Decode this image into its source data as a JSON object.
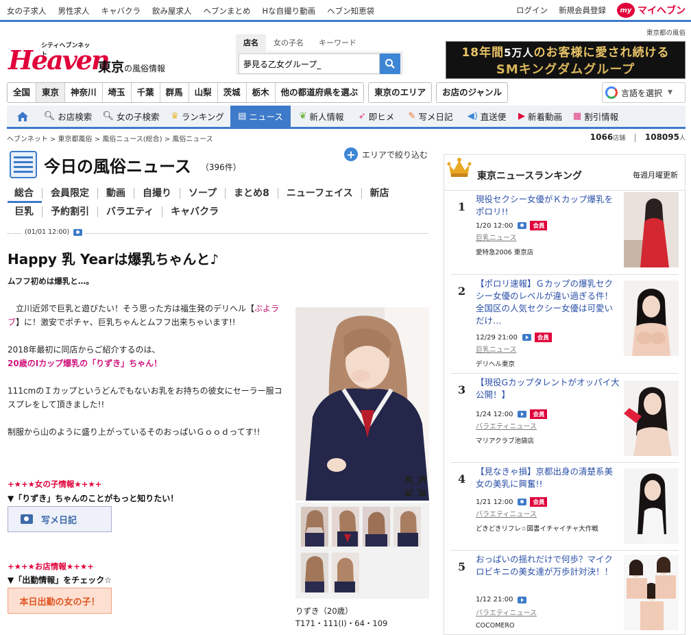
{
  "topbar": {
    "links": [
      "女の子求人",
      "男性求人",
      "キャバクラ",
      "飲み屋求人",
      "ヘブンまとめ",
      "Hな自撮り動画",
      "ヘブン知恵袋"
    ],
    "login": "ログイン",
    "register": "新規会員登録",
    "my_badge": "my",
    "my_heaven": "マイヘブン"
  },
  "header": {
    "pref_label": "東京都の風俗",
    "logo_small": "シティヘブンネット",
    "logo_big": "Heaven",
    "region": "東京",
    "region_sub": "の風俗情報",
    "search_tabs": [
      "店名",
      "女の子名",
      "キーワード"
    ],
    "search_value": "夢見る乙女グループ_",
    "banner_line1_a": "18年間",
    "banner_line1_b": "5万人",
    "banner_line1_c": "のお客様に愛され続ける",
    "banner_line2": "SMキングダムグループ"
  },
  "areas": [
    "全国",
    "東京",
    "神奈川",
    "埼玉",
    "千葉",
    "群馬",
    "山梨",
    "茨城",
    "栃木",
    "他の都道府県を選ぶ"
  ],
  "area_link": "東京のエリア",
  "genre_link": "お店のジャンル",
  "translate": "言語を選択",
  "mainnav": [
    {
      "label": "",
      "icon": "home-icon"
    },
    {
      "label": "お店検索",
      "icon": "search-icon"
    },
    {
      "label": "女の子検索",
      "icon": "search-icon"
    },
    {
      "label": "ランキング",
      "icon": "crown-icon"
    },
    {
      "label": "ニュース",
      "icon": "news-icon"
    },
    {
      "label": "新人情報",
      "icon": "leaf-icon"
    },
    {
      "label": "即ヒメ",
      "icon": "rocket-icon"
    },
    {
      "label": "写メ日記",
      "icon": "pencil-icon"
    },
    {
      "label": "直送便",
      "icon": "speaker-icon"
    },
    {
      "label": "新着動画",
      "icon": "play-icon"
    },
    {
      "label": "割引情報",
      "icon": "coupon-icon"
    }
  ],
  "breadcrumb": "ヘブンネット > 東京都風俗 > 風俗ニュース(総合) > 風俗ニュース",
  "counts": {
    "shops": "1066",
    "shops_unit": "店舗",
    "girls": "108095",
    "girls_unit": "人"
  },
  "page": {
    "narrow_label": "エリアで絞り込む",
    "title": "今日の風俗ニュース",
    "count": "（396件）",
    "cats_row1": [
      "総合",
      "会員限定",
      "動画",
      "自撮り",
      "ソープ",
      "まとめ8",
      "ニューフェイス",
      "新店"
    ],
    "cats_row2": [
      "巨乳",
      "予約割引",
      "バラエティ",
      "キャバクラ"
    ]
  },
  "article": {
    "datetime": "(01/01 12:00)",
    "title": "Happy 乳 Yearは爆乳ちゃんと♪",
    "lead": "ムフフ初めは爆乳と…。",
    "p1a": "　立川近郊で巨乳と遊びたい！そう思った方は福生発のデリヘル【",
    "p1_shop": "ぷよラブ",
    "p1b": "】に！激安でポチャ、巨乳ちゃんとムフフ出来ちゃいます!!",
    "p2": "2018年最初に同店からご紹介するのは、",
    "p2_highlight": "20歳のIカップ爆乳の「りずき」ちゃん！",
    "p3": "111cmのＩカップというどんでもないお乳をお持ちの彼女にセーラー服コスプレをして頂きました!!",
    "p4": "制服から山のように盛り上がっているそのおっぱいＧｏｏｄってす!!",
    "girl_section": "+★+★女の子情報★+★+",
    "girl_sub": "▼「りずき」ちゃんのことがもっと知りたい！",
    "diary_button": "写メ日記",
    "shop_section": "+★+★お店情報★+★+",
    "shop_sub": "▼「出勤情報」をチェック☆",
    "today_button": "本日出勤の女の子！",
    "girl_name": "りずき（20歳）",
    "girl_size": "T171・111(I)・64・109"
  },
  "ranking": {
    "title": "東京ニュースランキング",
    "weekly": "毎週月曜更新",
    "items": [
      {
        "rank": "1",
        "title": "現役セクシー女優がＫカップ爆乳をポロリ!!",
        "date": "1/20 12:00",
        "member": "会員",
        "category": "巨乳ニュース",
        "shop": "愛特急2006 東京店",
        "media": "camera-icon"
      },
      {
        "rank": "2",
        "title": "【ポロリ速報】Ｇカップの爆乳セクシー女優のレベルが違い過ぎる件！全国区の人気セクシー女優は可愛いだけ…",
        "date": "12/29 21:00",
        "member": "会員",
        "category": "巨乳ニュース",
        "shop": "デリヘル東京",
        "media": "video-icon"
      },
      {
        "rank": "3",
        "title": "【現役Gカップタレントがオッパイ大公開！】",
        "date": "1/24 12:00",
        "member": "会員",
        "category": "バラエティニュース",
        "shop": "マリアクラブ池袋店",
        "media": "video-icon"
      },
      {
        "rank": "4",
        "title": "【見なきゃ損】京都出身の清楚系美女の美乳に興奮!!",
        "date": "1/21 12:00",
        "member": "会員",
        "category": "バラエティニュース",
        "shop": "どきどきリフレ☆図書イチャイチャ大作戦",
        "media": "camera-icon"
      },
      {
        "rank": "5",
        "title": "おっぱいの揺れだけで何歩？マイクロビキニの美女達が万歩計対決！！",
        "date": "1/12 21:00",
        "member": "",
        "category": "バラエティニュース",
        "shop": "COCOMERO",
        "media": "video-icon"
      }
    ]
  },
  "colors": {
    "accent": "#3d7ac9",
    "brand": "#e0003a",
    "highlight": "#d0157e"
  }
}
